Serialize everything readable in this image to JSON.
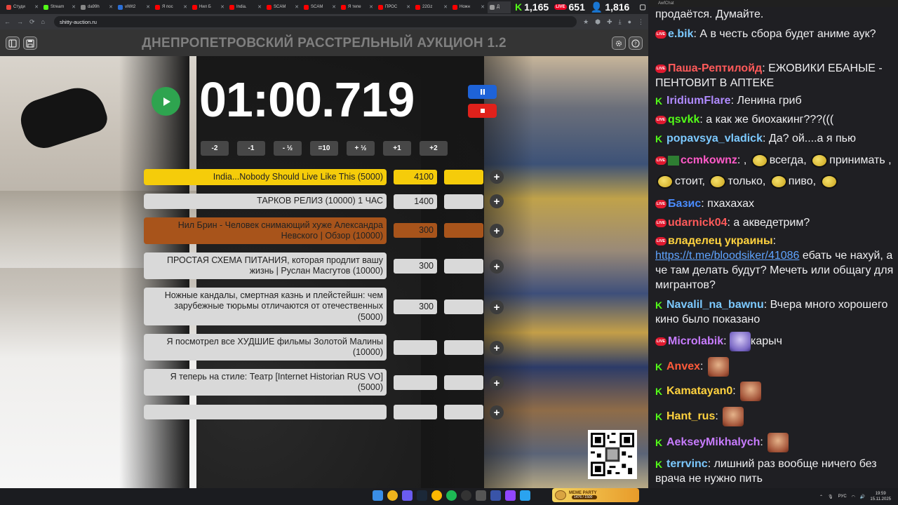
{
  "browser": {
    "tabs": [
      "Студи",
      "Stream",
      "da99h",
      "vIWt2",
      "Я пос",
      "Нил Б",
      "India.",
      "SCAM",
      "SCAM",
      "Я тепе",
      "ПРОС",
      "22Gz",
      "Ножн",
      "Д"
    ],
    "url": "shitty-auction.ru"
  },
  "stream_counters": {
    "kick_viewers": "1,165",
    "live_viewers": "651",
    "total_viewers": "1,816"
  },
  "auction": {
    "title": "ДНЕПРОПЕТРОВСКИЙ РАССТРЕЛЬНЫЙ АУКЦИОН 1.2",
    "timer": "01:00.719",
    "time_buttons": [
      "-2",
      "-1",
      "- ½",
      "=10",
      "+ ½",
      "+1",
      "+2"
    ],
    "add_label": "+",
    "lots": [
      {
        "name": "India...Nobody Should Live Like This (5000)",
        "amount": "4100",
        "color": "#f5cc0a"
      },
      {
        "name": "ТАРКОВ РЕЛИЗ (10000) 1 ЧАС",
        "amount": "1400",
        "color": "#d9d9d9"
      },
      {
        "name": "Нил Брин - Человек снимающий хуже Александра Невского | Обзор (10000)",
        "amount": "300",
        "color": "#a8541b"
      },
      {
        "name": "ПРОСТАЯ СХЕМА ПИТАНИЯ, которая продлит вашу жизнь | Руслан Масгутов (10000)",
        "amount": "300",
        "color": "#d9d9d9"
      },
      {
        "name": "Ножные кандалы, смертная казнь и плейстейшн: чем зарубежные тюрьмы отличаются от отечественных (5000)",
        "amount": "300",
        "color": "#d9d9d9"
      },
      {
        "name": "Я посмотрел все ХУДШИЕ фильмы Золотой Малины (10000)",
        "amount": "",
        "color": "#d9d9d9"
      },
      {
        "name": "Я теперь на стиле: Театр [Internet Historian RUS VO] (5000)",
        "amount": "",
        "color": "#d9d9d9"
      },
      {
        "name": "",
        "amount": "",
        "color": "#d9d9d9"
      }
    ]
  },
  "taskbar": {
    "meme_title": "MEME PARTY",
    "meme_progress": "1476 / 1500"
  },
  "tray": {
    "lang": "РУС",
    "time": "19:59",
    "date": "15.11.2025"
  },
  "chat": {
    "window_title": "AwfChat",
    "messages": [
      {
        "platform": "",
        "nick": "",
        "color": "#efeff1",
        "text": "продаётся. Думайте."
      },
      {
        "platform": "live",
        "nick": "e.bik",
        "color": "#7cc9ff",
        "text": "А в честь сбора будет аниме аук?"
      },
      {
        "platform": "live",
        "nick": "Паша-Рептилойд",
        "color": "#ff5a5a",
        "text": "ЕЖОВИКИ ЕБАНЫЕ - ПЕНТОВИТ В АПТЕКЕ"
      },
      {
        "platform": "kick",
        "nick": "IridiumFlare",
        "color": "#b08bff",
        "text": "Ленина гриб"
      },
      {
        "platform": "live",
        "nick": "qsvkk",
        "color": "#53fc18",
        "text": "а как же биохакинг???((("
      },
      {
        "platform": "kick",
        "nick": "popavsya_vladick",
        "color": "#7cc9ff",
        "text": "Да? ой....а я пью"
      },
      {
        "platform": "live",
        "nick": "ccmkownz",
        "color": "#ff5ac8",
        "text": "",
        "emote_words": [
          "всегда",
          "принимать",
          "стоит",
          "только",
          "пиво"
        ]
      },
      {
        "platform": "live",
        "nick": "Базис",
        "color": "#4a8cff",
        "text": "пхахахах"
      },
      {
        "platform": "live",
        "nick": "udarnick04",
        "color": "#ff5a5a",
        "text": "а акведетрим?"
      },
      {
        "platform": "live",
        "nick": "владелец украины",
        "color": "#ffd23f",
        "link": "https://t.me/bloodsiker/41086",
        "text": "ебать че нахуй, а че там делать будут? Мечеть или общагу для мигрантов?"
      },
      {
        "platform": "kick",
        "nick": "Navalil_na_bawnu",
        "color": "#7cc9ff",
        "text": "Вчера много хорошего кино было показано"
      },
      {
        "platform": "live",
        "nick": "Microlabik",
        "color": "#c87cff",
        "text": "карыч"
      },
      {
        "platform": "kick",
        "nick": "Anvex",
        "color": "#ff5a3a",
        "text": ""
      },
      {
        "platform": "kick",
        "nick": "Kamatayan0",
        "color": "#ffd23f",
        "text": ""
      },
      {
        "platform": "kick",
        "nick": "Hant_rus",
        "color": "#ffd23f",
        "text": ""
      },
      {
        "platform": "kick",
        "nick": "AekseyMikhalych",
        "color": "#c87cff",
        "text": ""
      },
      {
        "platform": "kick",
        "nick": "terrvinc",
        "color": "#7cc9ff",
        "text": "лишний раз вообще ничего без врача не нужно пить"
      }
    ]
  }
}
